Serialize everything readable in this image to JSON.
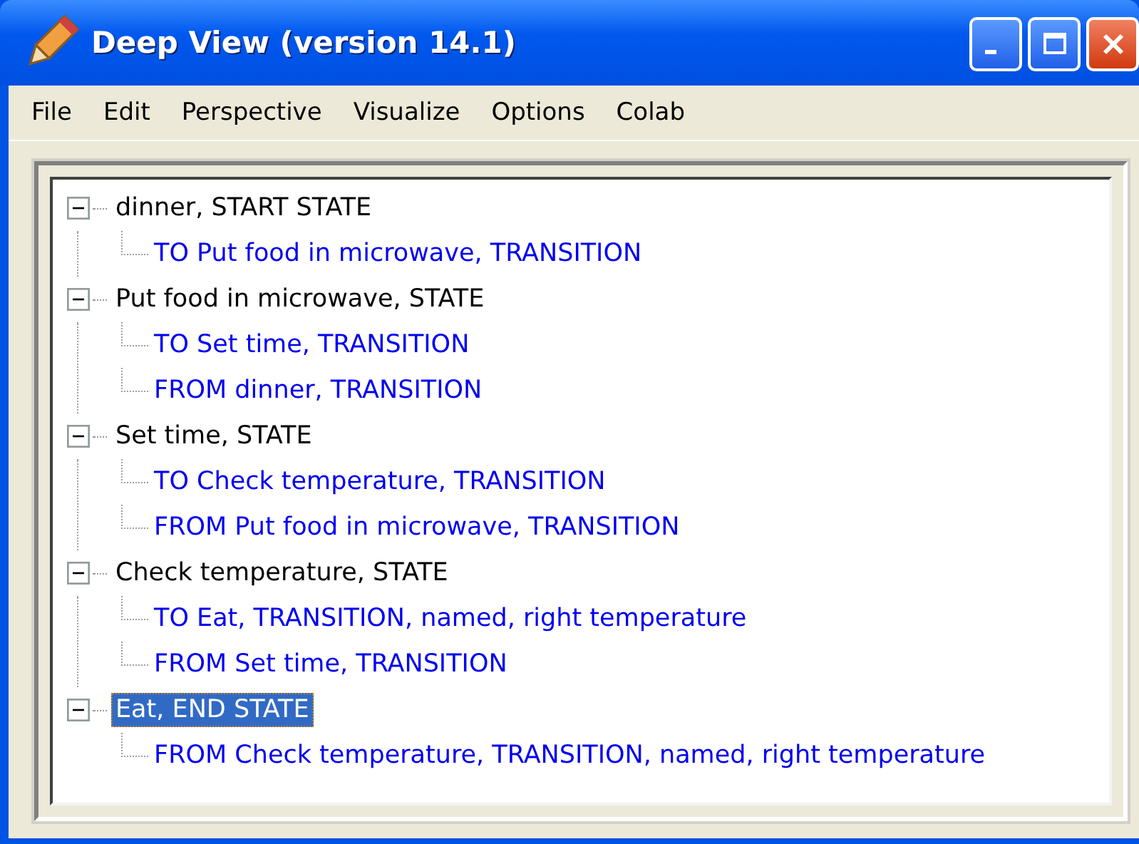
{
  "window": {
    "title": "Deep View (version 14.1)"
  },
  "menu": [
    "File",
    "Edit",
    "Perspective",
    "Visualize",
    "Options",
    "Colab"
  ],
  "tree": [
    {
      "label": "dinner, START STATE",
      "expanded": true,
      "selected": false,
      "children": [
        {
          "label": "TO Put food in microwave, TRANSITION"
        }
      ]
    },
    {
      "label": "Put food in microwave, STATE",
      "expanded": true,
      "selected": false,
      "children": [
        {
          "label": "TO Set time, TRANSITION"
        },
        {
          "label": "FROM dinner, TRANSITION"
        }
      ]
    },
    {
      "label": "Set time, STATE",
      "expanded": true,
      "selected": false,
      "children": [
        {
          "label": "TO Check temperature, TRANSITION"
        },
        {
          "label": "FROM Put food in microwave, TRANSITION"
        }
      ]
    },
    {
      "label": "Check temperature, STATE",
      "expanded": true,
      "selected": false,
      "children": [
        {
          "label": "TO Eat, TRANSITION, named, right temperature"
        },
        {
          "label": "FROM Set time, TRANSITION"
        }
      ]
    },
    {
      "label": "Eat, END STATE",
      "expanded": true,
      "selected": true,
      "children": [
        {
          "label": "FROM Check temperature, TRANSITION, named, right temperature"
        }
      ]
    }
  ]
}
